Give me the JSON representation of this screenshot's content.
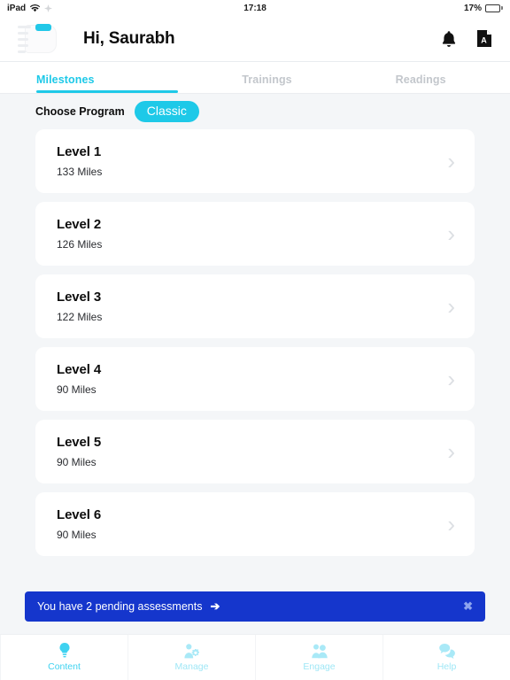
{
  "statusbar": {
    "device": "iPad",
    "wifi_icon": "wifi-icon",
    "location_icon": "location-icon",
    "time": "17:18",
    "battery_percent": "17%",
    "battery_level": 17
  },
  "header": {
    "logo_icon": "app-logo-icon",
    "greeting": "Hi, Saurabh",
    "notifications_icon": "bell-icon",
    "document_icon": "document-a-icon"
  },
  "tabs": [
    {
      "label": "Milestones",
      "active": true
    },
    {
      "label": "Trainings",
      "active": false
    },
    {
      "label": "Readings",
      "active": false
    }
  ],
  "program": {
    "label": "Choose Program",
    "selected": "Classic",
    "pill_color": "#1ec9e8"
  },
  "levels": [
    {
      "title": "Level 1",
      "subtitle": "133 Miles",
      "chevron": "›"
    },
    {
      "title": "Level 2",
      "subtitle": "126 Miles",
      "chevron": "›"
    },
    {
      "title": "Level 3",
      "subtitle": "122 Miles",
      "chevron": "›"
    },
    {
      "title": "Level 4",
      "subtitle": "90 Miles",
      "chevron": "›"
    },
    {
      "title": "Level 5",
      "subtitle": "90 Miles",
      "chevron": "›"
    },
    {
      "title": "Level 6",
      "subtitle": "90 Miles",
      "chevron": "›"
    }
  ],
  "banner": {
    "text": "You have 2 pending assessments",
    "arrow": "➔",
    "close": "✖",
    "background_color": "#1536cc"
  },
  "bottom_nav": [
    {
      "label": "Content",
      "icon": "lightbulb-icon",
      "active": true
    },
    {
      "label": "Manage",
      "icon": "person-gear-icon",
      "active": false
    },
    {
      "label": "Engage",
      "icon": "people-group-icon",
      "active": false
    },
    {
      "label": "Help",
      "icon": "chat-bubbles-icon",
      "active": false
    }
  ]
}
